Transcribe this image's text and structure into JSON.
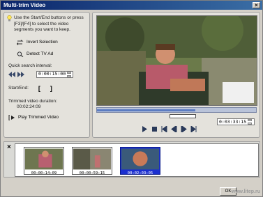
{
  "window": {
    "title": "Multi-trim Video"
  },
  "left_panel": {
    "info_text": "Use the Start/End buttons or press [F3]/[F4] to select the video segments you want to keep.",
    "invert_selection": "Invert Selection",
    "detect_tv_ad": "Detect TV Ad",
    "quick_search_label": "Quick search interval:",
    "quick_search_value": "0:00:15:00",
    "start_end_label": "Start/End:",
    "trimmed_duration_label": "Trimmed video duration:",
    "trimmed_duration_value": "00:02:24:09",
    "play_trimmed": "Play Trimmed Video"
  },
  "player": {
    "timecode": "0:03:33:15",
    "trim_progress": 0.62
  },
  "clips": [
    {
      "caption": "00:00:14:09",
      "selected": false
    },
    {
      "caption": "00:00:59:15",
      "selected": false
    },
    {
      "caption": "00:02:03:05",
      "selected": true
    }
  ],
  "footer": {
    "ok_label": "OK",
    "watermark": "www.litep.ru"
  },
  "colors": {
    "title_bar": "#0a246a",
    "selection": "#1b2fd0",
    "trim_fill": "#5b7cc2"
  }
}
